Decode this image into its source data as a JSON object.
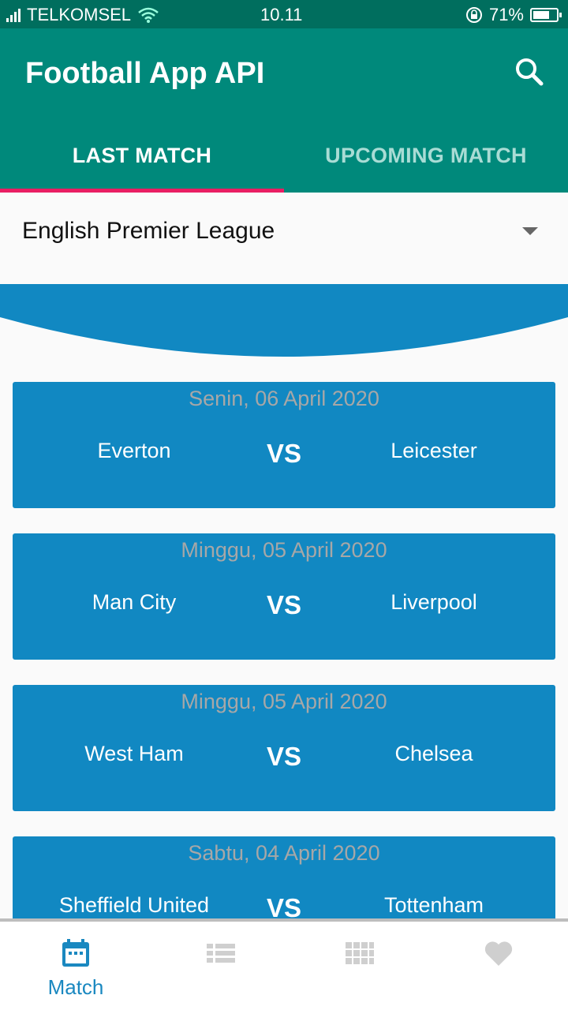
{
  "status_bar": {
    "carrier": "TELKOMSEL",
    "time": "10.11",
    "battery": "71%",
    "battery_level": 0.71
  },
  "app_bar": {
    "title": "Football App API",
    "search_icon": "search-icon"
  },
  "tabs": [
    {
      "label": "LAST MATCH",
      "active": true
    },
    {
      "label": "UPCOMING MATCH",
      "active": false
    }
  ],
  "league_select": {
    "value": "English Premier League"
  },
  "matches": [
    {
      "date": "Senin, 06 April 2020",
      "home": "Everton",
      "vs": "VS",
      "away": "Leicester"
    },
    {
      "date": "Minggu, 05 April 2020",
      "home": "Man City",
      "vs": "VS",
      "away": "Liverpool"
    },
    {
      "date": "Minggu, 05 April 2020",
      "home": "West Ham",
      "vs": "VS",
      "away": "Chelsea"
    },
    {
      "date": "Sabtu, 04 April 2020",
      "home": "Sheffield United",
      "vs": "VS",
      "away": "Tottenham"
    }
  ],
  "bottom_nav": [
    {
      "label": "Match",
      "icon": "calendar-icon",
      "active": true
    },
    {
      "label": "",
      "icon": "list-icon",
      "active": false
    },
    {
      "label": "",
      "icon": "grid-icon",
      "active": false
    },
    {
      "label": "",
      "icon": "heart-icon",
      "active": false
    }
  ],
  "colors": {
    "primary": "#00897b",
    "primary_dark": "#006e5e",
    "accent": "#e91e63",
    "card": "#1188c2"
  }
}
